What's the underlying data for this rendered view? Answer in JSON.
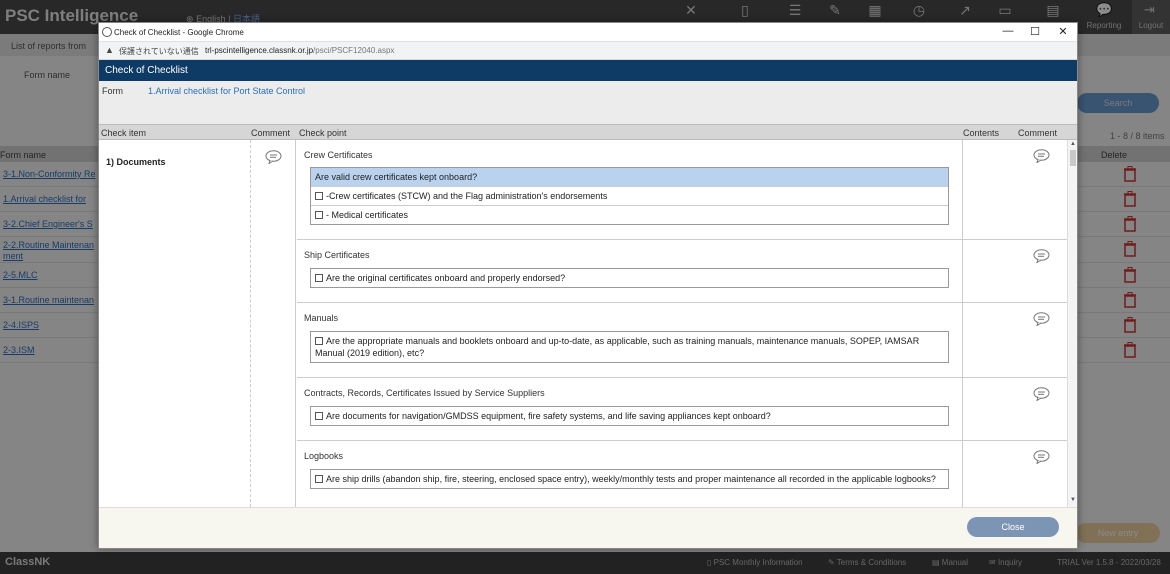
{
  "app": {
    "title": "PSC Intelligence",
    "lang_en": "English",
    "lang_sep": "|",
    "lang_jp": "日本語",
    "reporting": "Reporting",
    "logout": "Logout",
    "subbar": "List of reports from",
    "form_name_label": "Form name",
    "search_label": "Search",
    "counter": "1 - 8 / 8 items",
    "col_form_name": "Form name",
    "col_delete": "Delete",
    "rows": [
      "3-1.Non-Conformity Re",
      "1.Arrival checklist for",
      "3-2.Chief Engineer's S",
      "2-2.Routine Maintenan",
      "ment",
      "2-5.MLC",
      "3-1.Routine maintenan",
      "2-4.ISPS",
      "2-3.ISM"
    ],
    "new_entry": "New entry",
    "footer": {
      "brand": "ClassNK",
      "monthly": "PSC Monthly Information",
      "terms": "Terms & Conditions",
      "manual": "Manual",
      "inquiry": "Inquiry",
      "version": "TRIAL Ver 1.5.8 - 2022/03/28"
    }
  },
  "browser": {
    "window_title": "Check of Checklist - Google Chrome",
    "not_secure": "保護されていない通信",
    "url_host": "trl-pscintelligence.classnk.or.jp",
    "url_path": "/psci/PSCF12040.aspx",
    "minimize": "—",
    "maximize": "☐",
    "close": "✕"
  },
  "dialog": {
    "title": "Check of Checklist",
    "form_label": "Form",
    "form_value": "1.Arrival checklist for Port State Control",
    "headers": {
      "check_item": "Check item",
      "comment": "Comment",
      "check_point": "Check point",
      "contents": "Contents",
      "comment2": "Comment"
    },
    "check_item": "1) Documents",
    "sections": [
      {
        "name": "Crew Certificates",
        "questions": [
          "Are valid crew certificates kept onboard?",
          "-Crew certificates (STCW) and the Flag administration's endorsements",
          "- Medical certificates"
        ]
      },
      {
        "name": "Ship Certificates",
        "questions": [
          "Are the original certificates onboard and properly endorsed?"
        ]
      },
      {
        "name": "Manuals",
        "questions": [
          "Are the appropriate manuals and booklets onboard and up-to-date, as applicable, such as training manuals, maintenance manuals, SOPEP, IAMSAR Manual (2019 edition), etc?"
        ]
      },
      {
        "name": "Contracts, Records, Certificates Issued by Service Suppliers",
        "questions": [
          "Are documents for navigation/GMDSS equipment, fire safety systems, and life saving appliances kept onboard?"
        ]
      },
      {
        "name": "Logbooks",
        "questions": [
          "Are ship drills (abandon ship, fire, steering, enclosed space entry), weekly/monthly tests and proper maintenance all recorded in the applicable logbooks?"
        ]
      }
    ],
    "close_label": "Close"
  }
}
